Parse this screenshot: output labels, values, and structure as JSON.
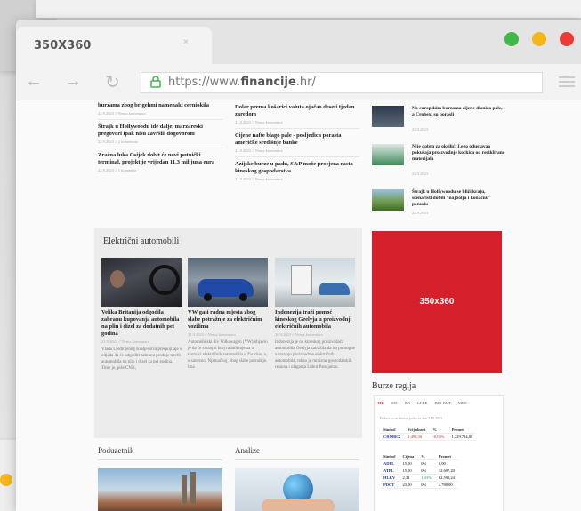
{
  "tab": {
    "title": "350X360",
    "close": "×"
  },
  "toolbar": {
    "back": "←",
    "forward": "→",
    "reload": "↻",
    "url_prefix": "https://www.",
    "url_domain": "financije",
    "url_suffix": ".hr/"
  },
  "colors": {
    "dot_green": "#3fb845",
    "dot_yellow": "#f3b71c",
    "dot_red": "#ec3a35",
    "ad_red": "#d51f2a"
  },
  "left_articles": [
    {
      "title": "burzama zbog brigehmi namenaki cerniokila",
      "meta": "22.9.2023 // Nema komentara"
    },
    {
      "title": "Štrajk u Hollywoodu ide dalje, marzareski pregovori ipak nisu završili dogovorom",
      "meta": "22.9.2023 // 2 komentara"
    },
    {
      "title": "Zračna luka Osijek dobit će novi putnički terminal, projekt je vrijedan 11,3 milijuna eura",
      "meta": "22.9.2023 // 1 komentar"
    }
  ],
  "mid_articles": [
    {
      "title": "Dolar prema košarici valuta ojačao deseti tjedan zaredom",
      "meta": "22.9.2023 // Nema komentara"
    },
    {
      "title": "Cijene nafte blago pale - posljedica porasta američke središnje banke",
      "meta": "22.9.2023 // Nema komentara"
    },
    {
      "title": "Azijske burze u padu, S&P može procjena rasta kineskog gospodarstva",
      "meta": "22.9.2023 // Nema komentara"
    }
  ],
  "elektricni": {
    "heading": "Električni automobili",
    "cards": [
      {
        "title": "Velika Britanija odgodila zabranu kupovanja automobila na plin i dizel za dodatnih pet godina",
        "meta": "21.9.2023 // Nema komentara",
        "excerpt": "Vlada Ujedinjenog Kraljevstva prespojilaje s odjeda da će odgoditi zabranu prodaje novih automobila na plin i dizel za pet godina. Time je, piše CNN,"
      },
      {
        "title": "VW gasi radna mjesta zbog slabe potražnje za električnim vozilima",
        "meta": "21.9.2023 // Nema komentara",
        "excerpt": "Automobilski div Volkswagen (VW) objavio je da će smanjiti broj radnih mjesta u tvornici električnih automobila u Zwickau u, u saveznoj Njemačkoj, zbog slabe potražnje. Ima"
      },
      {
        "title": "Indonezija traži pomoć kineskog Geelyja u proizvodnji električnih automobila",
        "meta": "20.9.2023 // Nema komentara",
        "excerpt": "Indonezija je od kineskog proizvođača automobila Geelyja zatražila da im pomogne u razvoju proizvodnje električnih automobila, rekao je ministar gospodarskih resursa i ulaganja Luhut Pandjaitan."
      }
    ]
  },
  "sections": {
    "poduzetnik": "Poduzetnik",
    "analize": "Analize"
  },
  "sidebar": [
    {
      "title": "Na europskim burzama cijene dionica pale, a Crobexi su porasli",
      "meta": "22.9.2023"
    },
    {
      "title": "Nije dobra za oksilić: Lego odustavao pokušaja proizvodnje kockica od reciklirane materijala",
      "meta": "22.9.2023"
    },
    {
      "title": "Štrajk u Hollywoodu se bliži kraju, scenaristi dobili \"najbolju i konačnu\" ponudu",
      "meta": "22.9.2023"
    }
  ],
  "ad": {
    "label": "350x360"
  },
  "burze": {
    "heading": "Burze regija",
    "tabs": [
      "HR",
      "SEI",
      "BX",
      "LEI-R",
      "BIR-BUT",
      "MNE"
    ],
    "note": "Podaci su na dnevni pošto za dan 22.9.2023",
    "index_head": [
      "Simbol",
      "Vrijednost",
      "%",
      "Promet"
    ],
    "index_row": [
      "CROBEX",
      "2.490,30",
      "-0,03%",
      "1.229.724,00"
    ],
    "stock_head": [
      "Simbol",
      "Cijena",
      "%",
      "Promet"
    ],
    "stocks": [
      [
        "ADPL",
        "15,00",
        "0%",
        "0,00"
      ],
      [
        "ATPL",
        "15,00",
        "0%",
        "32.697,20"
      ],
      [
        "HLKV",
        "2,32",
        "1,43%",
        "62.592,24"
      ],
      [
        "PDCT",
        "23,00",
        "0%",
        "4.780,00"
      ]
    ]
  }
}
